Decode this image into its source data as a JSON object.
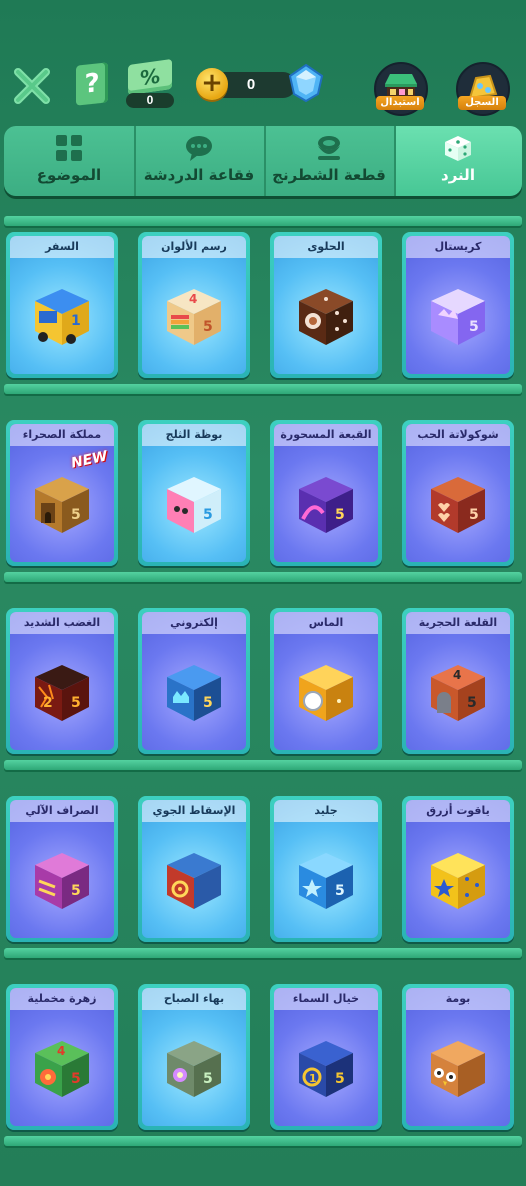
{
  "header": {
    "coupon_symbol": "%",
    "coupon_count": "0",
    "help_symbol": "?",
    "gem_count": "0",
    "plus_symbol": "+",
    "store_label": "استبدال",
    "record_label": "السجل"
  },
  "tabs": [
    {
      "label": "النرد",
      "icon": "dice-icon",
      "active": true
    },
    {
      "label": "قطعة الشطرنج",
      "icon": "chess-piece-icon",
      "active": false
    },
    {
      "label": "فقاعة الدردشة",
      "icon": "chat-bubble-icon",
      "active": false
    },
    {
      "label": "الموضوع",
      "icon": "theme-grid-icon",
      "active": false
    }
  ],
  "rows": [
    {
      "items": [
        {
          "name": "كريستال",
          "color": "#b9a6ff",
          "style": "purple"
        },
        {
          "name": "الحلوى",
          "color": "#6b3a1e",
          "style": "blue"
        },
        {
          "name": "رسم الألوان",
          "color": "#f1d7a8",
          "style": "blue"
        },
        {
          "name": "السفر",
          "color": "#3b8be0",
          "style": "blue"
        }
      ]
    },
    {
      "items": [
        {
          "name": "شوكولاتة الحب",
          "color": "#b23a2b",
          "style": "purple"
        },
        {
          "name": "القبعة المسحورة",
          "color": "#5a2fb0",
          "style": "purple"
        },
        {
          "name": "بوظة الثلج",
          "color": "#ff7fb5",
          "style": "blue"
        },
        {
          "name": "مملكة الصحراء",
          "color": "#b57a2c",
          "style": "purple",
          "badge": "NEW"
        }
      ]
    },
    {
      "items": [
        {
          "name": "القلعة الحجرية",
          "color": "#c9582b",
          "style": "purple"
        },
        {
          "name": "الماس",
          "color": "#f0a41c",
          "style": "purple"
        },
        {
          "name": "إلكتروني",
          "color": "#2a73c8",
          "style": "purple"
        },
        {
          "name": "الغضب الشديد",
          "color": "#7a1a12",
          "style": "purple"
        }
      ]
    },
    {
      "items": [
        {
          "name": "ياقوت أزرق",
          "color": "#f2c21a",
          "style": "purple"
        },
        {
          "name": "جليد",
          "color": "#2a8be0",
          "style": "blue"
        },
        {
          "name": "الإسقاط الجوي",
          "color": "#c23a2a",
          "style": "blue"
        },
        {
          "name": "الصراف الآلي",
          "color": "#a83ba8",
          "style": "purple"
        }
      ]
    },
    {
      "items": [
        {
          "name": "بومة",
          "color": "#d5823c",
          "style": "purple"
        },
        {
          "name": "خيال السماء",
          "color": "#2a4aa8",
          "style": "purple"
        },
        {
          "name": "بهاء الصباح",
          "color": "#6f8a6a",
          "style": "blue"
        },
        {
          "name": "زهرة مخملية",
          "color": "#3aa24a",
          "style": "purple"
        }
      ]
    }
  ]
}
